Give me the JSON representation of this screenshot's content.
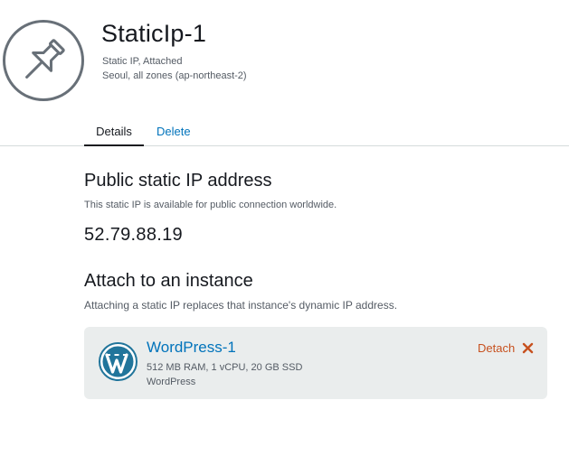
{
  "header": {
    "icon": "pushpin-icon",
    "title": "StaticIp-1",
    "status": "Static IP, Attached",
    "location": "Seoul, all zones (ap-northeast-2)"
  },
  "tabs": [
    {
      "label": "Details",
      "active": true
    },
    {
      "label": "Delete",
      "active": false
    }
  ],
  "public_ip": {
    "title": "Public static IP address",
    "description": "This static IP is available for public connection worldwide.",
    "value": "52.79.88.19"
  },
  "attach": {
    "title": "Attach to an instance",
    "description": "Attaching a static IP replaces that instance's dynamic IP address.",
    "instance": {
      "icon": "wordpress-icon",
      "name": "WordPress-1",
      "specs": "512 MB RAM, 1 vCPU, 20 GB SSD",
      "blueprint": "WordPress",
      "detach_label": "Detach",
      "detach_icon": "close-icon"
    }
  },
  "colors": {
    "link": "#0073bb",
    "detach": "#c7511f",
    "card_bg": "#eaeded",
    "icon_gray": "#687078"
  }
}
